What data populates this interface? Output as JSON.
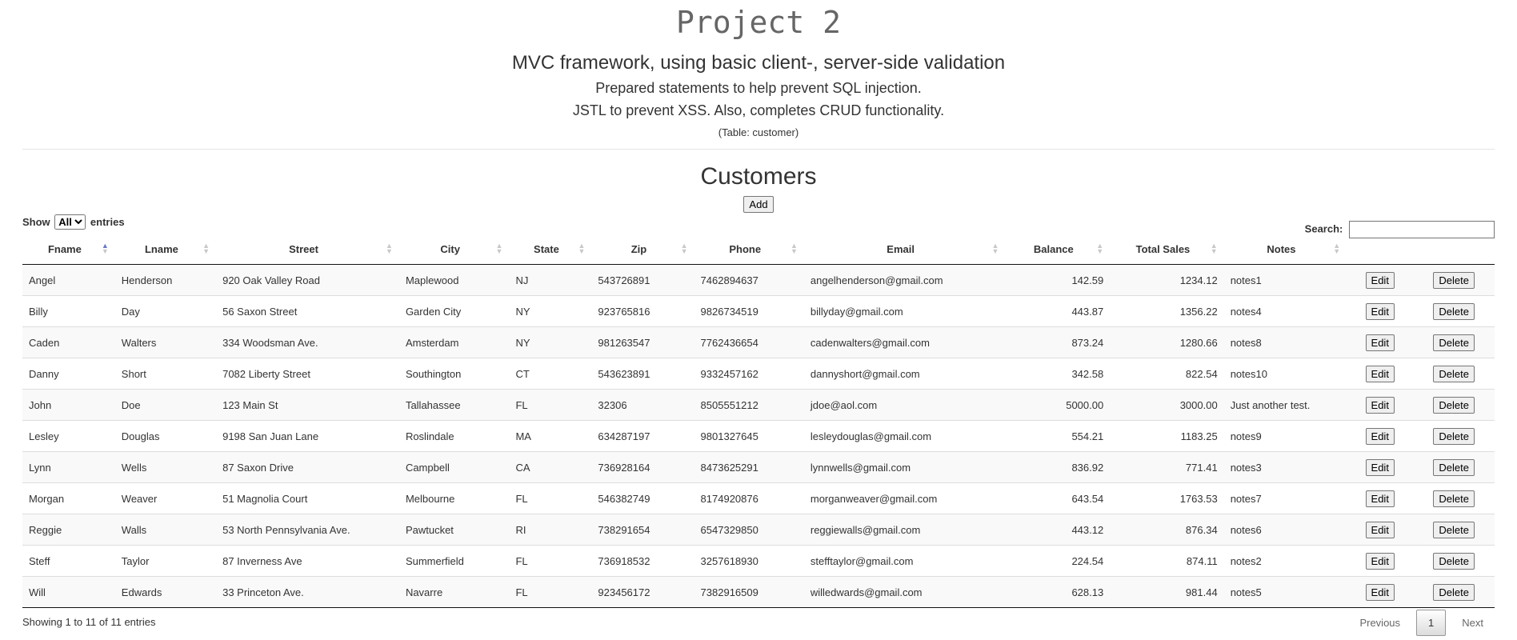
{
  "header": {
    "title": "Project 2",
    "subtitle": "MVC framework, using basic client-, server-side validation",
    "line1": "Prepared statements to help prevent SQL injection.",
    "line2": "JSTL to prevent XSS. Also, completes CRUD functionality.",
    "line3": "(Table: customer)"
  },
  "customers": {
    "title": "Customers",
    "add_label": "Add"
  },
  "controls": {
    "show_label": "Show",
    "show_value": "All",
    "entries_label": "entries",
    "search_label": "Search:",
    "search_value": ""
  },
  "table": {
    "columns": [
      "Fname",
      "Lname",
      "Street",
      "City",
      "State",
      "Zip",
      "Phone",
      "Email",
      "Balance",
      "Total Sales",
      "Notes"
    ],
    "sorted_column": "Fname",
    "edit_label": "Edit",
    "delete_label": "Delete",
    "rows": [
      [
        "Angel",
        "Henderson",
        "920 Oak Valley Road",
        "Maplewood",
        "NJ",
        "543726891",
        "7462894637",
        "angelhenderson@gmail.com",
        "142.59",
        "1234.12",
        "notes1"
      ],
      [
        "Billy",
        "Day",
        "56 Saxon Street",
        "Garden City",
        "NY",
        "923765816",
        "9826734519",
        "billyday@gmail.com",
        "443.87",
        "1356.22",
        "notes4"
      ],
      [
        "Caden",
        "Walters",
        "334 Woodsman Ave.",
        "Amsterdam",
        "NY",
        "981263547",
        "7762436654",
        "cadenwalters@gmail.com",
        "873.24",
        "1280.66",
        "notes8"
      ],
      [
        "Danny",
        "Short",
        "7082 Liberty Street",
        "Southington",
        "CT",
        "543623891",
        "9332457162",
        "dannyshort@gmail.com",
        "342.58",
        "822.54",
        "notes10"
      ],
      [
        "John",
        "Doe",
        "123 Main St",
        "Tallahassee",
        "FL",
        "32306",
        "8505551212",
        "jdoe@aol.com",
        "5000.00",
        "3000.00",
        "Just another test."
      ],
      [
        "Lesley",
        "Douglas",
        "9198 San Juan Lane",
        "Roslindale",
        "MA",
        "634287197",
        "9801327645",
        "lesleydouglas@gmail.com",
        "554.21",
        "1183.25",
        "notes9"
      ],
      [
        "Lynn",
        "Wells",
        "87 Saxon Drive",
        "Campbell",
        "CA",
        "736928164",
        "8473625291",
        "lynnwells@gmail.com",
        "836.92",
        "771.41",
        "notes3"
      ],
      [
        "Morgan",
        "Weaver",
        "51 Magnolia Court",
        "Melbourne",
        "FL",
        "546382749",
        "8174920876",
        "morganweaver@gmail.com",
        "643.54",
        "1763.53",
        "notes7"
      ],
      [
        "Reggie",
        "Walls",
        "53 North Pennsylvania Ave.",
        "Pawtucket",
        "RI",
        "738291654",
        "6547329850",
        "reggiewalls@gmail.com",
        "443.12",
        "876.34",
        "notes6"
      ],
      [
        "Steff",
        "Taylor",
        "87 Inverness Ave",
        "Summerfield",
        "FL",
        "736918532",
        "3257618930",
        "stefftaylor@gmail.com",
        "224.54",
        "874.11",
        "notes2"
      ],
      [
        "Will",
        "Edwards",
        "33 Princeton Ave.",
        "Navarre",
        "FL",
        "923456172",
        "7382916509",
        "willedwards@gmail.com",
        "628.13",
        "981.44",
        "notes5"
      ]
    ]
  },
  "footer": {
    "info": "Showing 1 to 11 of 11 entries",
    "previous": "Previous",
    "page": "1",
    "next": "Next"
  }
}
